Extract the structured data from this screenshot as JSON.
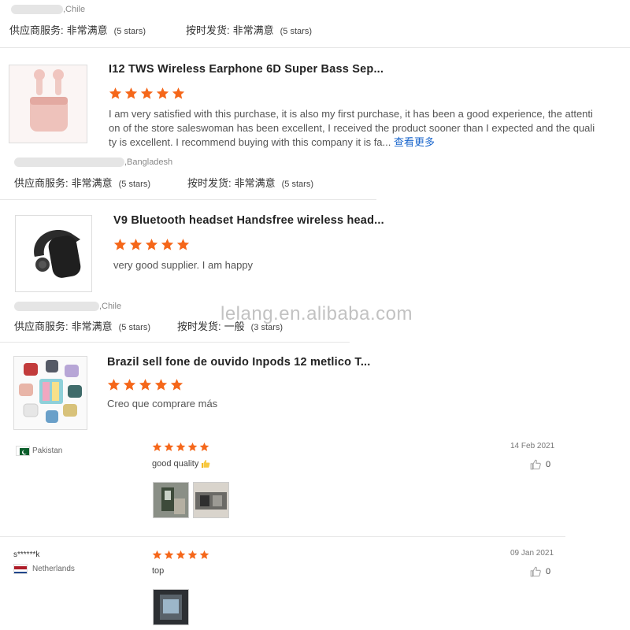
{
  "review0": {
    "location": ",Chile",
    "service_label": "供应商服务:",
    "service_value": "非常满意",
    "service_count": "(5 stars)",
    "delivery_label": "按时发货:",
    "delivery_value": "非常满意",
    "delivery_count": "(5 stars)"
  },
  "review1": {
    "title": "I12 TWS Wireless Earphone 6D Super Bass Sep...",
    "rating": 5,
    "text_line1": "I am very satisfied with this purchase, it is also my first purchase, it has been a good experience, the attenti",
    "text_line2": "on of the store saleswoman has been excellent, I received the product sooner than I expected and the quali",
    "text_line3": "ty is excellent. I recommend buying with this company it is fa...",
    "more_link": "查看更多",
    "location": ",Bangladesh",
    "service_label": "供应商服务:",
    "service_value": "非常满意",
    "service_count": "(5 stars)",
    "delivery_label": "按时发货:",
    "delivery_value": "非常满意",
    "delivery_count": "(5 stars)"
  },
  "review2": {
    "title": "V9 Bluetooth headset Handsfree wireless head...",
    "rating": 5,
    "text": "very good supplier. I am happy",
    "location": ",Chile",
    "service_label": "供应商服务:",
    "service_value": "非常满意",
    "service_count": "(5 stars)",
    "delivery_label": "按时发货:",
    "delivery_value": "一般",
    "delivery_count": "(3 stars)"
  },
  "watermark": "lelang.en.alibaba.com",
  "review3": {
    "title": "Brazil sell fone de ouvido Inpods 12 metlico T...",
    "rating": 5,
    "text": "Creo que comprare más"
  },
  "buyer_reviews": [
    {
      "country": "Pakistan",
      "rating": 5,
      "text": "good quality",
      "date": "14 Feb 2021",
      "likes": "0"
    },
    {
      "username": "s******k",
      "country": "Netherlands",
      "rating": 5,
      "text": "top",
      "date": "09 Jan 2021",
      "likes": "0"
    }
  ],
  "colors": {
    "star": "#f5671a",
    "link": "#1a66cc",
    "watermark": "#b8b8b8"
  },
  "icons": [
    "star-icon",
    "thumbs-up-icon",
    "pakistan-flag-icon",
    "netherlands-flag-icon"
  ]
}
